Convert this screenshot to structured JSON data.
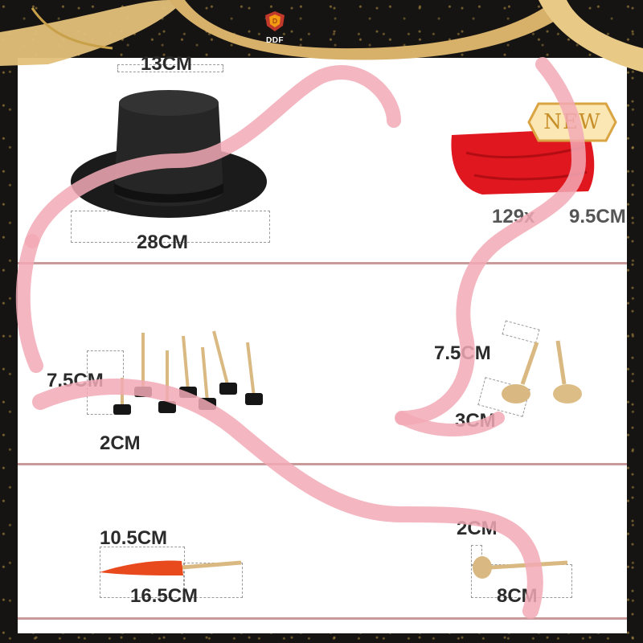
{
  "brand": {
    "logo_text": "DDF"
  },
  "badge": {
    "label": "NEW"
  },
  "items": {
    "hat": {
      "height_label": "13CM",
      "width_label": "28CM"
    },
    "scarf": {
      "count_label": "129x",
      "size_label": "9.5CM"
    },
    "black_buttons": {
      "height_label": "7.5CM",
      "width_label": "2CM"
    },
    "wood_buttons": {
      "height_label": "7.5CM",
      "width_label": "3CM"
    },
    "carrot": {
      "height_label": "10.5CM",
      "length_label": "16.5CM"
    },
    "wood_peg": {
      "height_label": "2CM",
      "length_label": "8CM"
    }
  },
  "colors": {
    "ribbon_pink": "#f2a9b5",
    "ribbon_gold": "#e3c07a",
    "scarf_red": "#e0171f",
    "carrot_orange": "#e84a1d",
    "wood": "#d9b981",
    "frame_dark": "#151412",
    "divider": "#c89a9a"
  },
  "icons": [
    "crest-logo-icon",
    "new-badge-icon",
    "ribbon-decoration"
  ]
}
